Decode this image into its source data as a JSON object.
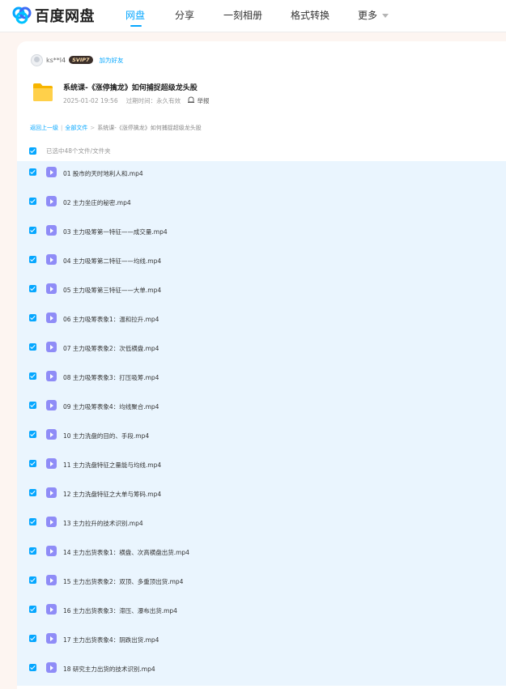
{
  "app": {
    "logo_text": "百度网盘",
    "nav": [
      {
        "label": "网盘",
        "active": true
      },
      {
        "label": "分享",
        "active": false
      },
      {
        "label": "一刻相册",
        "active": false
      },
      {
        "label": "格式转换",
        "active": false
      },
      {
        "label": "更多",
        "active": false
      }
    ],
    "accent_color": "#06a7ff"
  },
  "share": {
    "username": "ks**l4",
    "vip_badge": "SVIP7",
    "add_friend": "加为好友",
    "title": "系统课-《涨停擒龙》如何捕捉超级龙头股",
    "date": "2025-01-02 19:56",
    "expire": "过期时间：永久有效",
    "report": "举报"
  },
  "breadcrumb": {
    "back": "返回上一级",
    "all": "全部文件",
    "current": "系统课-《涨停擒龙》如何捕捉超级龙头股"
  },
  "selection": {
    "text": "已选中48个文件/文件夹"
  },
  "files": [
    {
      "name": "01 股市的天时地利人和.mp4",
      "checked": true
    },
    {
      "name": "02 主力坐庄的秘密.mp4",
      "checked": true
    },
    {
      "name": "03 主力吸筹第一特征——成交量.mp4",
      "checked": true
    },
    {
      "name": "04 主力吸筹第二特征——均线.mp4",
      "checked": true
    },
    {
      "name": "05 主力吸筹第三特征——大单.mp4",
      "checked": true
    },
    {
      "name": "06 主力吸筹表象1：温和拉升.mp4",
      "checked": true
    },
    {
      "name": "07 主力吸筹表象2：次低横盘.mp4",
      "checked": true
    },
    {
      "name": "08 主力吸筹表象3：打压吸筹.mp4",
      "checked": true
    },
    {
      "name": "09 主力吸筹表象4：均线聚合.mp4",
      "checked": true
    },
    {
      "name": "10 主力洗盘的目的、手段.mp4",
      "checked": true
    },
    {
      "name": "11 主力洗盘特征之量能与均线.mp4",
      "checked": true
    },
    {
      "name": "12 主力洗盘特征之大单与筹码.mp4",
      "checked": true
    },
    {
      "name": "13 主力拉升的技术识别.mp4",
      "checked": true
    },
    {
      "name": "14 主力出货表象1：横盘、次高横盘出货.mp4",
      "checked": true
    },
    {
      "name": "15 主力出货表象2：双顶、多重顶出货.mp4",
      "checked": true
    },
    {
      "name": "16 主力出货表象3：滞压、瀑布出货.mp4",
      "checked": true
    },
    {
      "name": "17 主力出货表象4：阴跌出货.mp4",
      "checked": true
    },
    {
      "name": "18 研究主力出货的技术识别.mp4",
      "checked": true
    }
  ]
}
